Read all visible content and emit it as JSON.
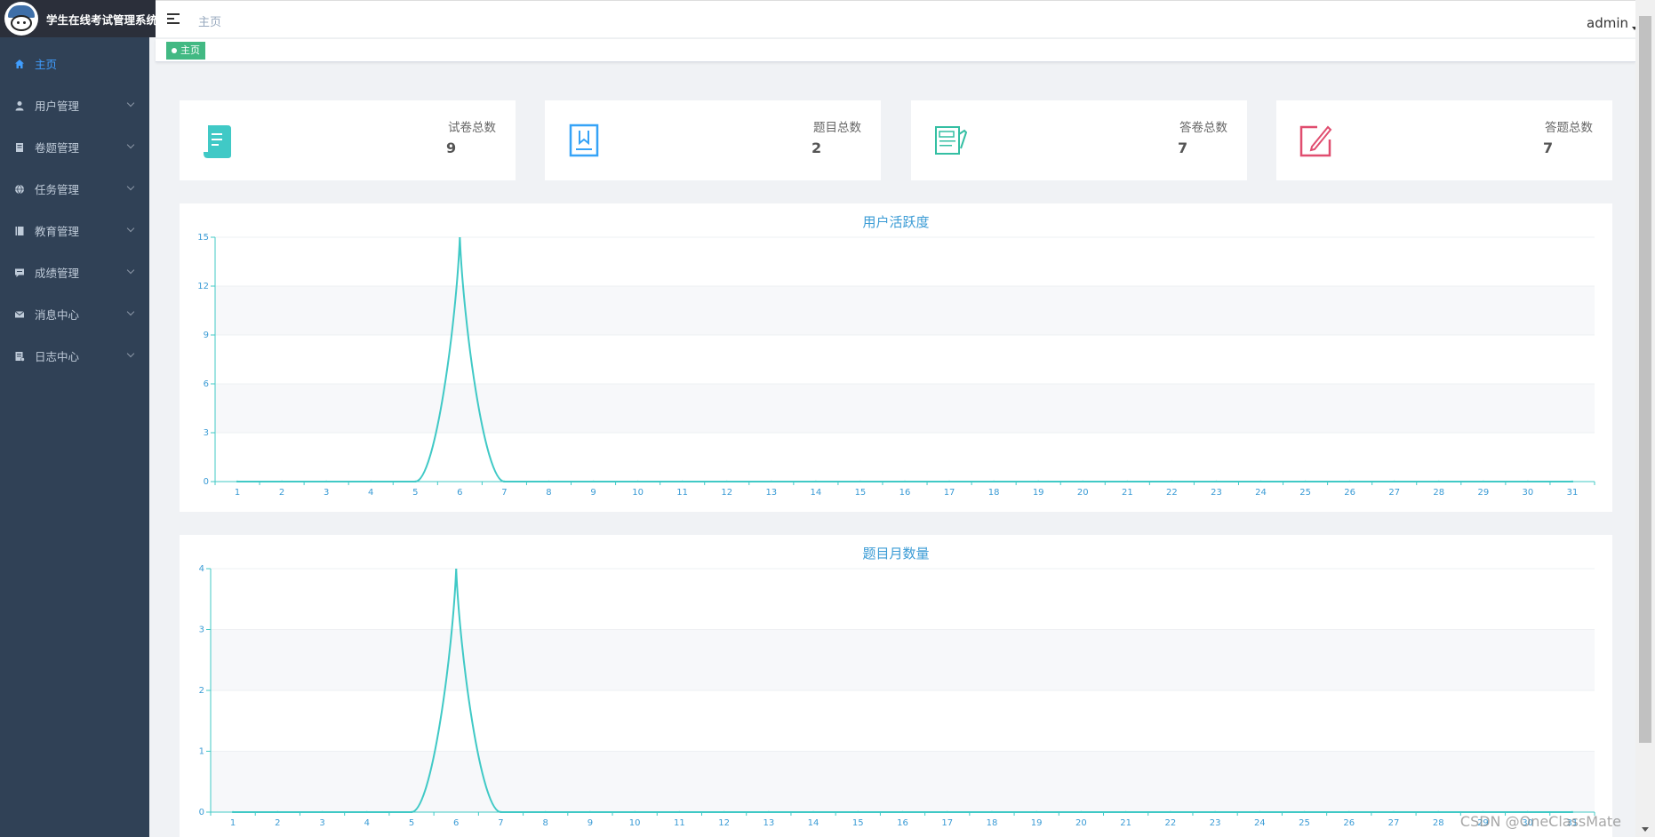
{
  "app": {
    "title": "学生在线考试管理系统"
  },
  "header": {
    "breadcrumb": "主页",
    "user": "admin"
  },
  "tags": [
    {
      "label": "主页"
    }
  ],
  "sidebar": {
    "items": [
      {
        "label": "主页",
        "icon": "home-icon",
        "active": true
      },
      {
        "label": "用户管理",
        "icon": "user-icon"
      },
      {
        "label": "卷题管理",
        "icon": "document-icon"
      },
      {
        "label": "任务管理",
        "icon": "globe-icon"
      },
      {
        "label": "教育管理",
        "icon": "book-icon"
      },
      {
        "label": "成绩管理",
        "icon": "chat-icon"
      },
      {
        "label": "消息中心",
        "icon": "mail-icon"
      },
      {
        "label": "日志中心",
        "icon": "log-icon"
      }
    ]
  },
  "cards": [
    {
      "label": "试卷总数",
      "value": "9",
      "icon": "scroll-icon",
      "color": "#40c9c6"
    },
    {
      "label": "题目总数",
      "value": "2",
      "icon": "bookmark-book-icon",
      "color": "#36a3f7"
    },
    {
      "label": "答卷总数",
      "value": "7",
      "icon": "answer-sheet-icon",
      "color": "#34bfa3"
    },
    {
      "label": "答题总数",
      "value": "7",
      "icon": "edit-icon",
      "color": "#e04d6f"
    }
  ],
  "chart_data": [
    {
      "type": "line",
      "title": "用户活跃度",
      "x": [
        1,
        2,
        3,
        4,
        5,
        6,
        7,
        8,
        9,
        10,
        11,
        12,
        13,
        14,
        15,
        16,
        17,
        18,
        19,
        20,
        21,
        22,
        23,
        24,
        25,
        26,
        27,
        28,
        29,
        30,
        31
      ],
      "y_ticks": [
        0,
        3,
        6,
        9,
        12,
        15
      ],
      "ylim": [
        0,
        15
      ],
      "series": [
        {
          "values": [
            0,
            0,
            0,
            0,
            0,
            15,
            0,
            0,
            0,
            0,
            0,
            0,
            0,
            0,
            0,
            0,
            0,
            0,
            0,
            0,
            0,
            0,
            0,
            0,
            0,
            0,
            0,
            0,
            0,
            0,
            0
          ]
        }
      ],
      "color": "#40c9c6",
      "grid": true
    },
    {
      "type": "line",
      "title": "题目月数量",
      "x": [
        1,
        2,
        3,
        4,
        5,
        6,
        7,
        8,
        9,
        10,
        11,
        12,
        13,
        14,
        15,
        16,
        17,
        18,
        19,
        20,
        21,
        22,
        23,
        24,
        25,
        26,
        27,
        28,
        29,
        30,
        31
      ],
      "y_ticks": [
        0,
        1,
        2,
        3,
        4
      ],
      "ylim": [
        0,
        4
      ],
      "series": [
        {
          "values": [
            0,
            0,
            0,
            0,
            0,
            4,
            0,
            0,
            0,
            0,
            0,
            0,
            0,
            0,
            0,
            0,
            0,
            0,
            0,
            0,
            0,
            0,
            0,
            0,
            0,
            0,
            0,
            0,
            0,
            0,
            0
          ]
        }
      ],
      "color": "#40c9c6",
      "grid": true
    }
  ],
  "watermark": "CSDN @OneClassMate"
}
